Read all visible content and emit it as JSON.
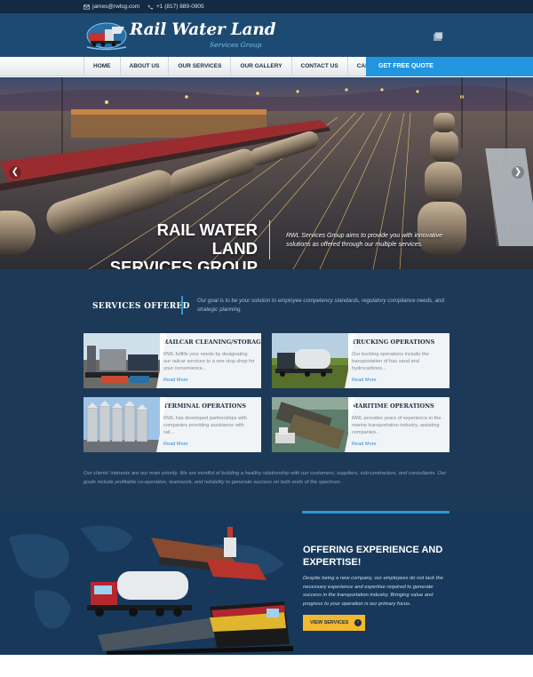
{
  "topbar": {
    "email": "james@rwlsg.com",
    "phone": "+1 (817) 889-0905"
  },
  "brand": {
    "name": "Rail Water Land",
    "tagline": "Services Group"
  },
  "nav": {
    "items": [
      "HOME",
      "ABOUT US",
      "OUR SERVICES",
      "OUR GALLERY",
      "CONTACT US",
      "CAREERS"
    ],
    "cta": "GET FREE QUOTE"
  },
  "hero": {
    "title_line1": "RAIL WATER LAND",
    "title_line2": "SERVICES GROUP",
    "text": "RWL Services Group aims to provide you with innovative solutions as offered through our multiple services."
  },
  "services": {
    "heading": "SERVICES OFFERED",
    "intro": "Our goal is to be your solution to employee competency standards, regulatory compliance needs, and strategic planning.",
    "cards": [
      {
        "title": "RAILCAR CLEANING/STORAGE",
        "desc": "RWL fulfills your needs by designating our railcar services to a one stop shop for your convenience...",
        "more": "Read More"
      },
      {
        "title": "TRUCKING OPERATIONS",
        "desc": "Our trucking operations include the transportation of frac sand and hydrocarbons...",
        "more": "Read More"
      },
      {
        "title": "TERMINAL OPERATIONS",
        "desc": "RWL has developed partnerships with companies providing assistance with rail...",
        "more": "Read More"
      },
      {
        "title": "MARITIME OPERATIONS",
        "desc": "RWL provides years of experience in the marine transportation industry, assisting companies...",
        "more": "Read More"
      }
    ],
    "footer": "Our clients' interests are our main priority. We are mindful of building a healthy relationship with our customers, suppliers, sub-contractors, and consultants. Our goals include profitable co-operation, teamwork, and reliability to generate success on both ends of the spectrum."
  },
  "offer": {
    "title": "OFFERING EXPERIENCE AND EXPERTISE!",
    "text": "Despite being a new company, our employees do not lack the necessary experience and expertise required to generate success in the transportation industry. Bringing value and progress to your operation is our primary focus.",
    "button": "VIEW SERVICES"
  },
  "colors": {
    "topbar": "#132a42",
    "header": "#1d4a72",
    "accent": "#2196df",
    "services_bg": "#1c3a57",
    "button_yellow": "#f2b92f"
  },
  "icons": [
    "mail-icon",
    "phone-icon",
    "logo-icon",
    "header-tool-icon",
    "arrow-left-icon",
    "arrow-right-icon",
    "arrow-circle-icon"
  ]
}
